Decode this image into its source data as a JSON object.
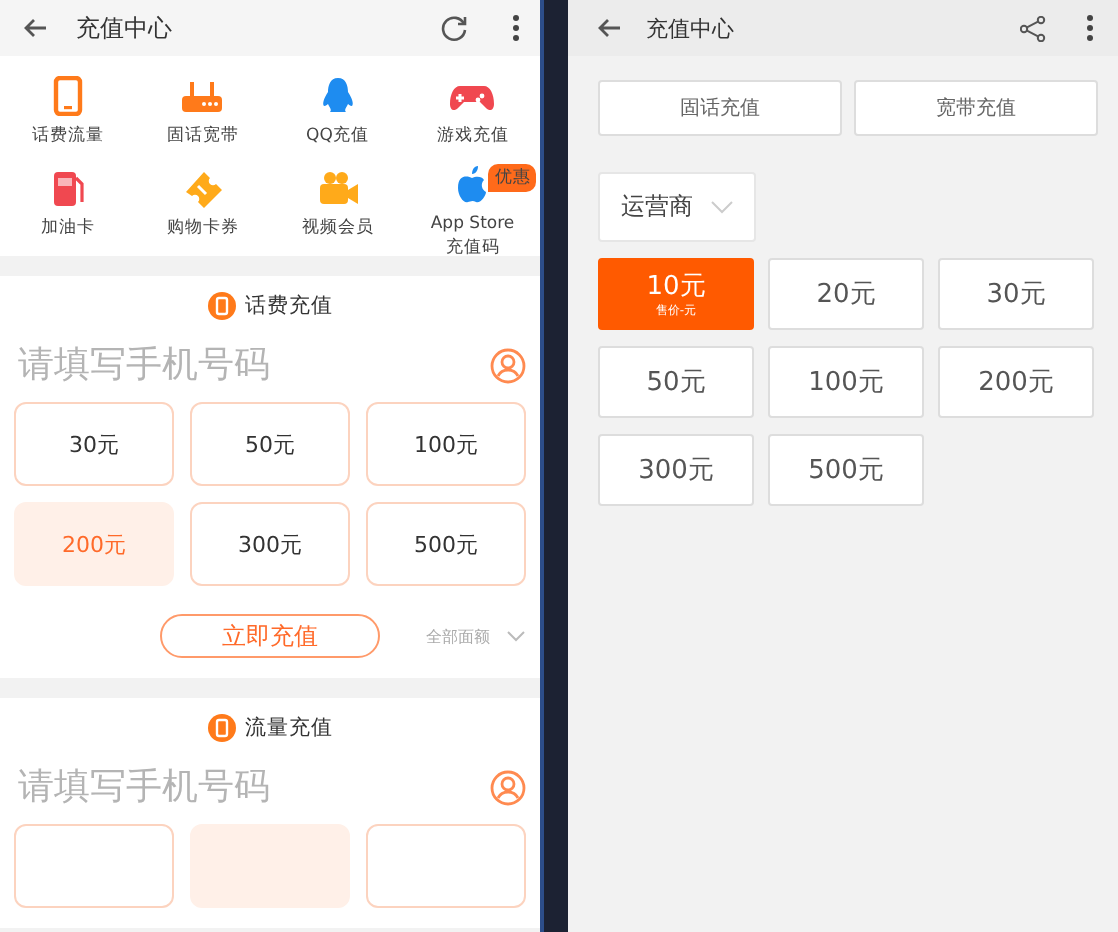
{
  "left": {
    "title": "充值中心",
    "categories": [
      {
        "label": "话费流量"
      },
      {
        "label": "固话宽带"
      },
      {
        "label": "QQ充值"
      },
      {
        "label": "游戏充值"
      },
      {
        "label": "加油卡"
      },
      {
        "label": "购物卡券"
      },
      {
        "label": "视频会员"
      },
      {
        "label": "App Store\n充值码",
        "badge": "优惠"
      }
    ],
    "sections": [
      {
        "title": "话费充值",
        "placeholder": "请填写手机号码",
        "amounts": [
          {
            "label": "30元",
            "selected": false
          },
          {
            "label": "50元",
            "selected": false
          },
          {
            "label": "100元",
            "selected": false
          },
          {
            "label": "200元",
            "selected": true
          },
          {
            "label": "300元",
            "selected": false
          },
          {
            "label": "500元",
            "selected": false
          }
        ],
        "submit": "立即充值",
        "more": "全部面额"
      },
      {
        "title": "流量充值",
        "placeholder": "请填写手机号码",
        "amounts": [
          {
            "selected": false
          },
          {
            "selected": true
          },
          {
            "selected": false
          }
        ]
      }
    ]
  },
  "right": {
    "title": "充值中心",
    "tabs": [
      "固话充值",
      "宽带充值"
    ],
    "carrier": "运营商",
    "amounts": [
      {
        "label": "10元",
        "sublabel": "售价-元",
        "selected": true
      },
      {
        "label": "20元",
        "selected": false
      },
      {
        "label": "30元",
        "selected": false
      },
      {
        "label": "50元",
        "selected": false
      },
      {
        "label": "100元",
        "selected": false
      },
      {
        "label": "200元",
        "selected": false
      },
      {
        "label": "300元",
        "selected": false
      },
      {
        "label": "500元",
        "selected": false
      }
    ]
  }
}
